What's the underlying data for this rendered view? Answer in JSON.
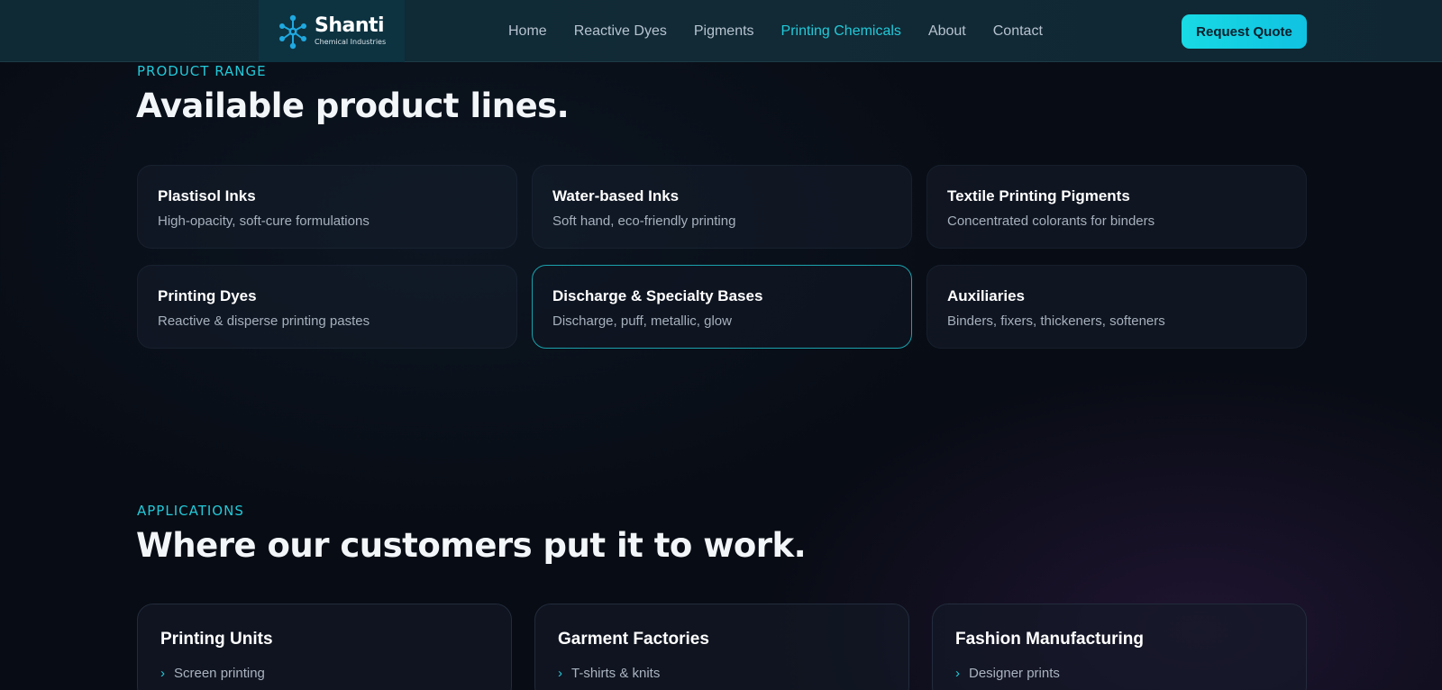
{
  "header": {
    "logo": {
      "name": "Shanti",
      "subtitle": "Chemical Industries"
    },
    "nav": [
      {
        "label": "Home"
      },
      {
        "label": "Reactive Dyes"
      },
      {
        "label": "Pigments"
      },
      {
        "label": "Printing Chemicals",
        "active": true
      },
      {
        "label": "About"
      },
      {
        "label": "Contact"
      }
    ],
    "cta_label": "Request Quote"
  },
  "product_range": {
    "eyebrow": "PRODUCT RANGE",
    "title": "Available product lines.",
    "cards": [
      {
        "name": "Plastisol Inks",
        "desc": "High-opacity, soft-cure formulations"
      },
      {
        "name": "Water-based Inks",
        "desc": "Soft hand, eco-friendly printing"
      },
      {
        "name": "Textile Printing Pigments",
        "desc": "Concentrated colorants for binders"
      },
      {
        "name": "Printing Dyes",
        "desc": "Reactive & disperse printing pastes"
      },
      {
        "name": "Discharge & Specialty Bases",
        "desc": "Discharge, puff, metallic, glow"
      },
      {
        "name": "Auxiliaries",
        "desc": "Binders, fixers, thickeners, softeners"
      }
    ]
  },
  "applications": {
    "eyebrow": "APPLICATIONS",
    "title": "Where our customers put it to work.",
    "cards": [
      {
        "name": "Printing Units",
        "items": [
          "Screen printing"
        ]
      },
      {
        "name": "Garment Factories",
        "items": [
          "T-shirts & knits"
        ]
      },
      {
        "name": "Fashion Manufacturing",
        "items": [
          "Designer prints"
        ]
      }
    ]
  },
  "colors": {
    "accent": "#22c9d9",
    "background": "#080c14",
    "header": "#112a36"
  }
}
